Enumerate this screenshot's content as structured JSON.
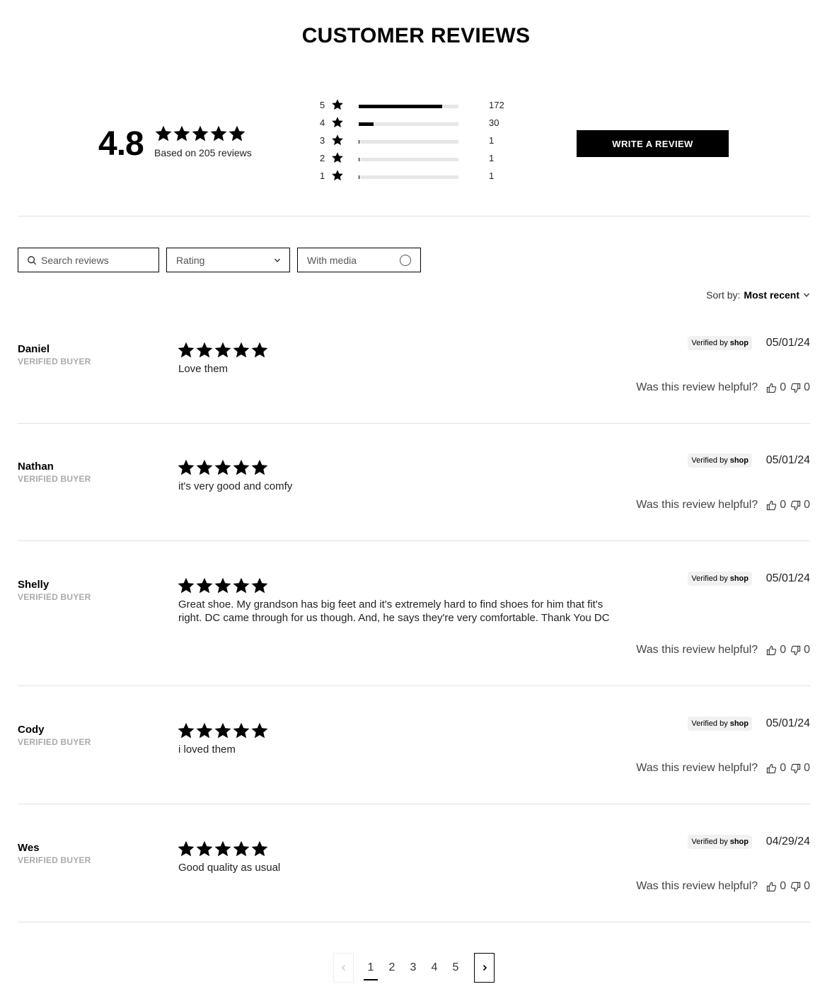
{
  "title": "CUSTOMER REVIEWS",
  "summary": {
    "average": "4.8",
    "stars": 5,
    "based_on": "Based on 205 reviews"
  },
  "histogram": [
    {
      "stars": "5",
      "count": "172",
      "fraction": 0.839
    },
    {
      "stars": "4",
      "count": "30",
      "fraction": 0.146
    },
    {
      "stars": "3",
      "count": "1",
      "fraction": 0.005
    },
    {
      "stars": "2",
      "count": "1",
      "fraction": 0.005
    },
    {
      "stars": "1",
      "count": "1",
      "fraction": 0.005
    }
  ],
  "write_review_label": "WRITE A REVIEW",
  "filters": {
    "search_placeholder": "Search reviews",
    "rating_label": "Rating",
    "media_label": "With media"
  },
  "sort": {
    "label": "Sort by:",
    "value": "Most recent"
  },
  "reviews": [
    {
      "name": "Daniel",
      "badge": "VERIFIED BUYER",
      "rating": 5,
      "body": "Love them",
      "verified_by": "Verified by",
      "shop": "shop",
      "date": "05/01/24",
      "helpful_label": "Was this review helpful?",
      "up": "0",
      "down": "0"
    },
    {
      "name": "Nathan",
      "badge": "VERIFIED BUYER",
      "rating": 5,
      "body": "it's very good and comfy",
      "verified_by": "Verified by",
      "shop": "shop",
      "date": "05/01/24",
      "helpful_label": "Was this review helpful?",
      "up": "0",
      "down": "0"
    },
    {
      "name": "Shelly",
      "badge": "VERIFIED BUYER",
      "rating": 5,
      "body": "Great shoe. My grandson has big feet and it's extremely hard to find shoes for him that fit's right. DC came through for us though. And, he says they're very comfortable. Thank You DC",
      "verified_by": "Verified by",
      "shop": "shop",
      "date": "05/01/24",
      "helpful_label": "Was this review helpful?",
      "up": "0",
      "down": "0"
    },
    {
      "name": "Cody",
      "badge": "VERIFIED BUYER",
      "rating": 5,
      "body": "i loved them",
      "verified_by": "Verified by",
      "shop": "shop",
      "date": "05/01/24",
      "helpful_label": "Was this review helpful?",
      "up": "0",
      "down": "0"
    },
    {
      "name": "Wes",
      "badge": "VERIFIED BUYER",
      "rating": 5,
      "body": "Good quality as usual",
      "verified_by": "Verified by",
      "shop": "shop",
      "date": "04/29/24",
      "helpful_label": "Was this review helpful?",
      "up": "0",
      "down": "0"
    }
  ],
  "pagination": {
    "pages": [
      "1",
      "2",
      "3",
      "4",
      "5"
    ],
    "current": "1"
  }
}
